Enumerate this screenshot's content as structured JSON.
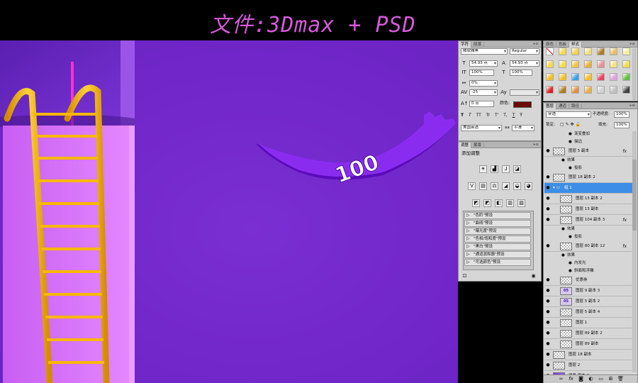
{
  "banner": {
    "title": "文件:3Dmax + PSD"
  },
  "canvas": {
    "badge_text": "100",
    "colors": {
      "background": "#7328cb",
      "ladder": "#f0b000",
      "ribbon": "#7b1fe0",
      "pillar": "#e070ff"
    }
  },
  "character_panel": {
    "tabs": [
      "字符",
      "段落"
    ],
    "font_family": "微软雅黑",
    "font_style": "Regular",
    "font_size": "54.93 点",
    "leading": "54.93 点",
    "vertical_scale": "100%",
    "horizontal_scale": "100%",
    "tracking_left": "0%",
    "tracking": "-25",
    "baseline_shift": "0 点",
    "color_label": "颜色:",
    "color_value": "#6b0a0a",
    "style_buttons": [
      "T",
      "T",
      "TT",
      "Tr",
      "T'",
      "T,",
      "T",
      "Ŧ"
    ],
    "language": "美国英语",
    "antialias_icon": "aa",
    "antialias": "平滑"
  },
  "styles_panel": {
    "tabs": [
      "颜色",
      "色板",
      "样式"
    ]
  },
  "adjustments_panel": {
    "tabs": [
      "调整",
      "蒙版"
    ],
    "title": "添加调整",
    "icons": [
      "☀",
      "▟",
      "⅃",
      "◪",
      "V",
      "▤",
      "⚖",
      "◢",
      "◒",
      "◕",
      "◩",
      "◩",
      "◧",
      "▥",
      "▨"
    ],
    "presets": [
      "\"色阶\"预设",
      "\"曲线\"预设",
      "\"曝光度\"预设",
      "\"色相/饱和度\"预设",
      "\"黑白\"预设",
      "\"通道混和器\"预设",
      "\"可选颜色\"预设"
    ]
  },
  "layers_panel": {
    "tabs": [
      "图层",
      "通道",
      "路径"
    ],
    "blend_mode": "穿透",
    "opacity_label": "不透明度:",
    "opacity": "100%",
    "lock_label": "锁定:",
    "fill_label": "填充:",
    "fill": "100%",
    "rows": [
      {
        "type": "effect",
        "name": "渐变叠加"
      },
      {
        "type": "effect",
        "name": "描边"
      },
      {
        "type": "layer",
        "name": "图层 5 副本",
        "fx": "fx"
      },
      {
        "type": "effect-group",
        "name": "效果"
      },
      {
        "type": "effect",
        "name": "投影"
      },
      {
        "type": "layer",
        "name": "图层 18 副本 2"
      },
      {
        "type": "group",
        "name": "组 1"
      },
      {
        "type": "layer",
        "name": "图层 13 副本 2"
      },
      {
        "type": "layer",
        "name": "图层 13 副本"
      },
      {
        "type": "layer",
        "name": "图层 104 副本 3",
        "fx": "fx"
      },
      {
        "type": "effect-group",
        "name": "效果"
      },
      {
        "type": "effect",
        "name": "投影"
      },
      {
        "type": "layer",
        "name": "图层 80 副本 12",
        "fx": "fx"
      },
      {
        "type": "effect-group",
        "name": "效果"
      },
      {
        "type": "effect",
        "name": "内发光"
      },
      {
        "type": "effect",
        "name": "斜面和浮雕"
      },
      {
        "type": "layer",
        "name": "优惠券"
      },
      {
        "type": "layer",
        "name": "图层 9 副本 3",
        "thumb_text": "05"
      },
      {
        "type": "layer",
        "name": "图层 5 副本 2",
        "thumb_text": "05"
      },
      {
        "type": "layer",
        "name": "图层 5 副本 4"
      },
      {
        "type": "layer",
        "name": "图层 1"
      },
      {
        "type": "layer",
        "name": "图层 89 副本 2"
      },
      {
        "type": "layer",
        "name": "图层 89 副本"
      },
      {
        "type": "layer",
        "name": "图层 18 副本"
      },
      {
        "type": "layer",
        "name": "图层 2"
      },
      {
        "type": "layer",
        "name": "背景 副本 2"
      }
    ],
    "footer_icons": [
      "link-icon",
      "fx-icon",
      "mask-icon",
      "adjust-icon",
      "folder-icon",
      "new-layer-icon",
      "trash-icon"
    ]
  }
}
